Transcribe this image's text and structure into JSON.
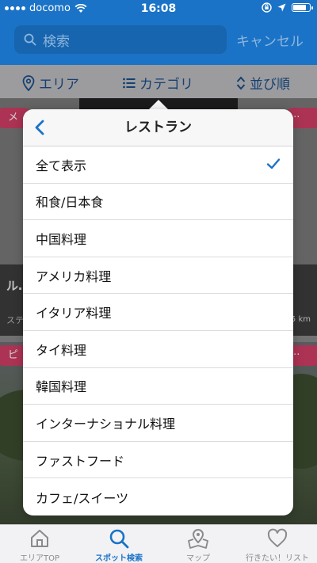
{
  "status_bar": {
    "carrier": "docomo",
    "time": "16:08"
  },
  "search": {
    "placeholder": "検索",
    "cancel_label": "キャンセル"
  },
  "filters": {
    "area": "エリア",
    "category": "カテゴリ",
    "sort": "並び順"
  },
  "background_cards": {
    "card1_title": "ル… イキ",
    "card1_subtitle": "ステ",
    "card1_distance": "5 km",
    "card1_left_badge": "メ",
    "card2_left_badge": "ピ"
  },
  "popover": {
    "title": "レストラン",
    "selected_index": 0,
    "items": [
      "全て表示",
      "和食/日本食",
      "中国料理",
      "アメリカ料理",
      "イタリア料理",
      "タイ料理",
      "韓国料理",
      "インターナショナル料理",
      "ファストフード",
      "カフェ/スイーツ"
    ]
  },
  "tabs": [
    {
      "label": "エリアTOP",
      "icon": "home-icon",
      "active": false
    },
    {
      "label": "スポット検索",
      "icon": "search-icon",
      "active": true
    },
    {
      "label": "マップ",
      "icon": "map-icon",
      "active": false
    },
    {
      "label": "行きたい！リスト",
      "icon": "heart-icon",
      "active": false
    }
  ],
  "colors": {
    "accent": "#1a73c6",
    "badge": "#d23f66",
    "check": "#1a73c6"
  }
}
